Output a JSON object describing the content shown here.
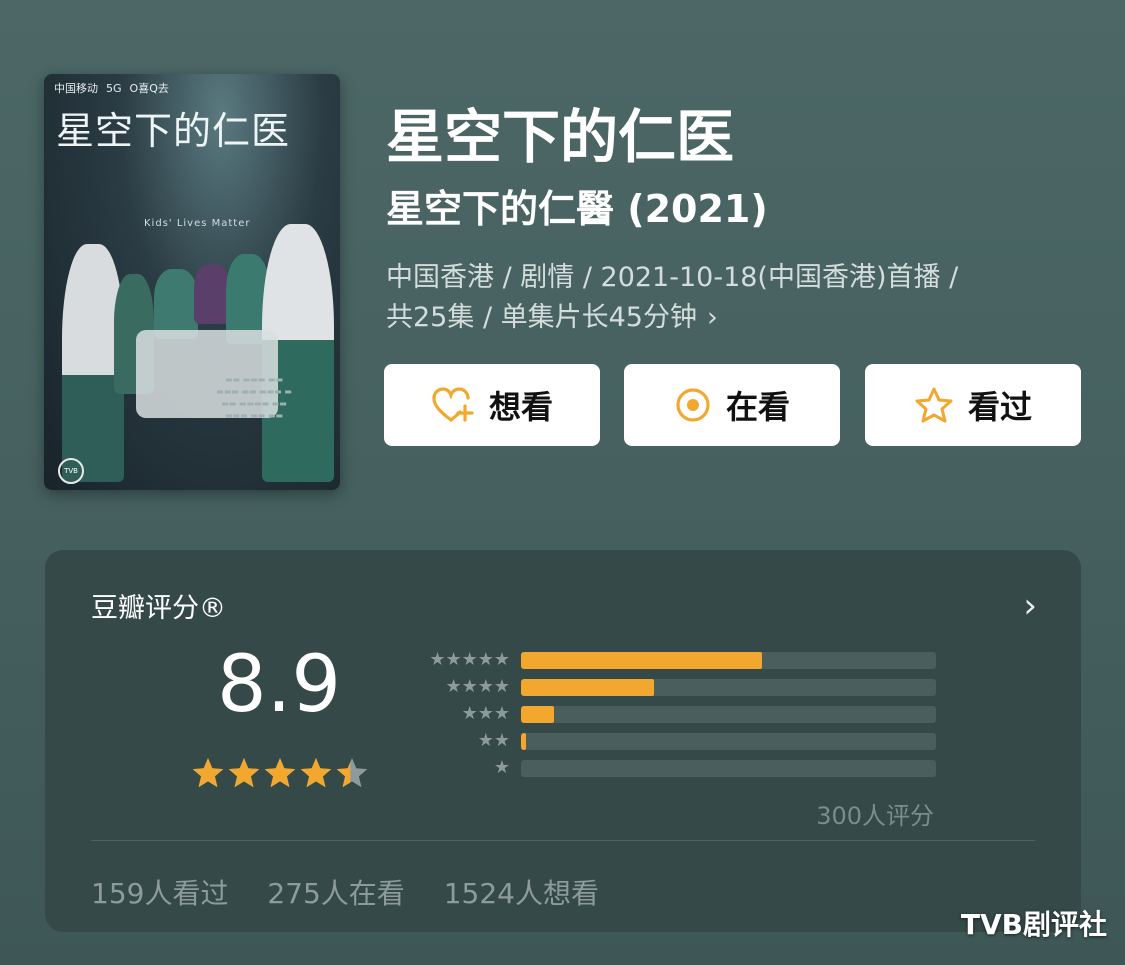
{
  "poster": {
    "top_badges": [
      "中国移动",
      "5G",
      "O喜Q去"
    ],
    "title_art": "星空下的仁医",
    "subtitle_art": "Kids' Lives Matter",
    "logo_text": "TVB"
  },
  "title": "星空下的仁医",
  "original_title": "星空下的仁醫 (2021)",
  "meta": {
    "line1": "中国香港 / 剧情 / 2021-10-18(中国香港)首播 /",
    "line2": "共25集 / 单集片长45分钟",
    "chevron": "›"
  },
  "actions": [
    {
      "label": "想看",
      "icon": "heart-plus-icon"
    },
    {
      "label": "在看",
      "icon": "target-icon"
    },
    {
      "label": "看过",
      "icon": "star-outline-icon"
    }
  ],
  "rating": {
    "label": "豆瓣评分®",
    "chevron": "›",
    "score": "8.9",
    "star_fill": 0.89,
    "distribution": [
      {
        "stars": "★★★★★",
        "fraction": 0.58
      },
      {
        "stars": "★★★★",
        "fraction": 0.32
      },
      {
        "stars": "★★★",
        "fraction": 0.08
      },
      {
        "stars": "★★",
        "fraction": 0.013
      },
      {
        "stars": "★",
        "fraction": 0.0
      }
    ],
    "count_label": "300人评分"
  },
  "stats": {
    "watched": "159人看过",
    "watching": "275人在看",
    "want": "1524人想看"
  },
  "watermark": "TVB剧评社",
  "colors": {
    "accent": "#f2a72f",
    "background": "#466160",
    "card": "#344948"
  }
}
